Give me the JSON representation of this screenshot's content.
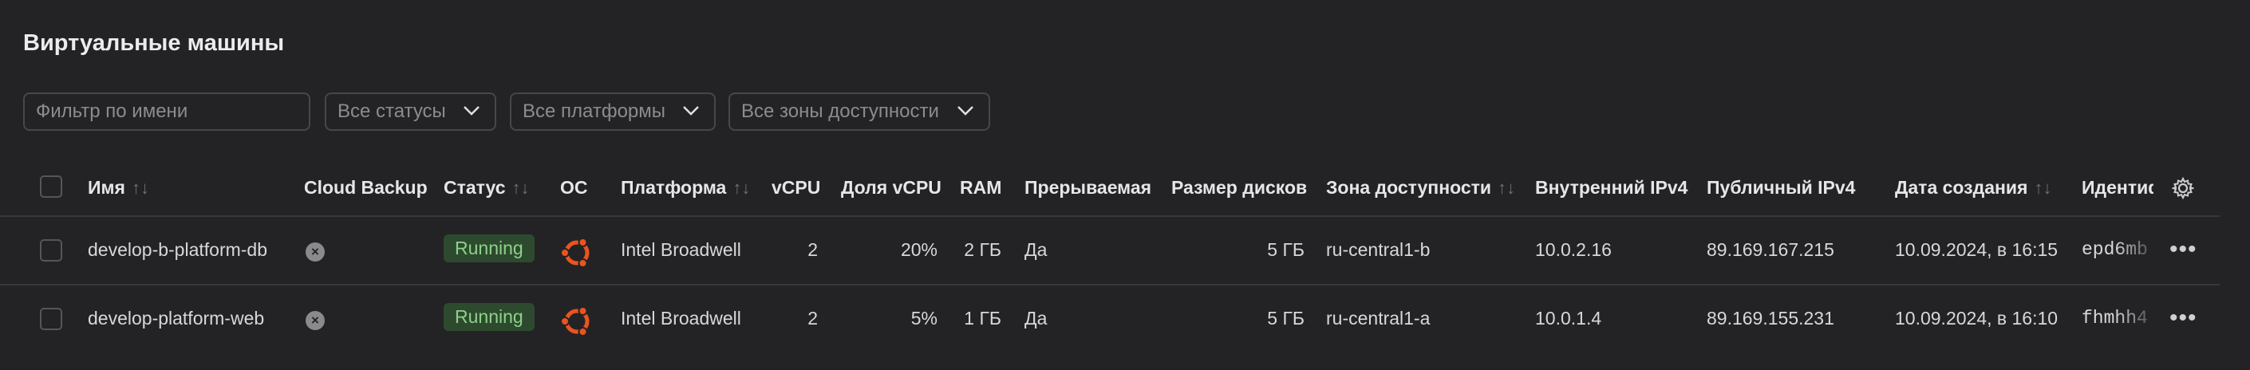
{
  "page_title": "Виртуальные машины",
  "filters": {
    "name_placeholder": "Фильтр по имени",
    "status": "Все статусы",
    "platform": "Все платформы",
    "zone": "Все зоны доступности"
  },
  "columns": {
    "name": "Имя",
    "backup": "Cloud Backup",
    "status": "Статус",
    "os": "ОС",
    "platform": "Платформа",
    "vcpu": "vCPU",
    "vcpu_share": "Доля vCPU",
    "ram": "RAM",
    "preemptible": "Прерываемая",
    "disk_size": "Размер дисков",
    "zone": "Зона доступности",
    "internal_ip": "Внутренний IPv4",
    "public_ip": "Публичный IPv4",
    "created": "Дата создания",
    "id": "Идентиф"
  },
  "rows": [
    {
      "name": "develop-b-platform-db",
      "status": "Running",
      "os_icon": "ubuntu-icon",
      "platform": "Intel Broadwell",
      "vcpu": "2",
      "vcpu_share": "20%",
      "ram": "2 ГБ",
      "preemptible": "Да",
      "disk_size": "5 ГБ",
      "zone": "ru-central1-b",
      "internal_ip": "10.0.2.16",
      "public_ip": "89.169.167.215",
      "created": "10.09.2024, в 16:15",
      "id": "epd6mb"
    },
    {
      "name": "develop-platform-web",
      "status": "Running",
      "os_icon": "ubuntu-icon",
      "platform": "Intel Broadwell",
      "vcpu": "2",
      "vcpu_share": "5%",
      "ram": "1 ГБ",
      "preemptible": "Да",
      "disk_size": "5 ГБ",
      "zone": "ru-central1-a",
      "internal_ip": "10.0.1.4",
      "public_ip": "89.169.155.231",
      "created": "10.09.2024, в 16:10",
      "id": "fhmhh4"
    }
  ],
  "colors": {
    "background": "#232325",
    "running_bg": "#2d4a2e",
    "running_text": "#8ed18a",
    "ubuntu": "#e95420"
  }
}
